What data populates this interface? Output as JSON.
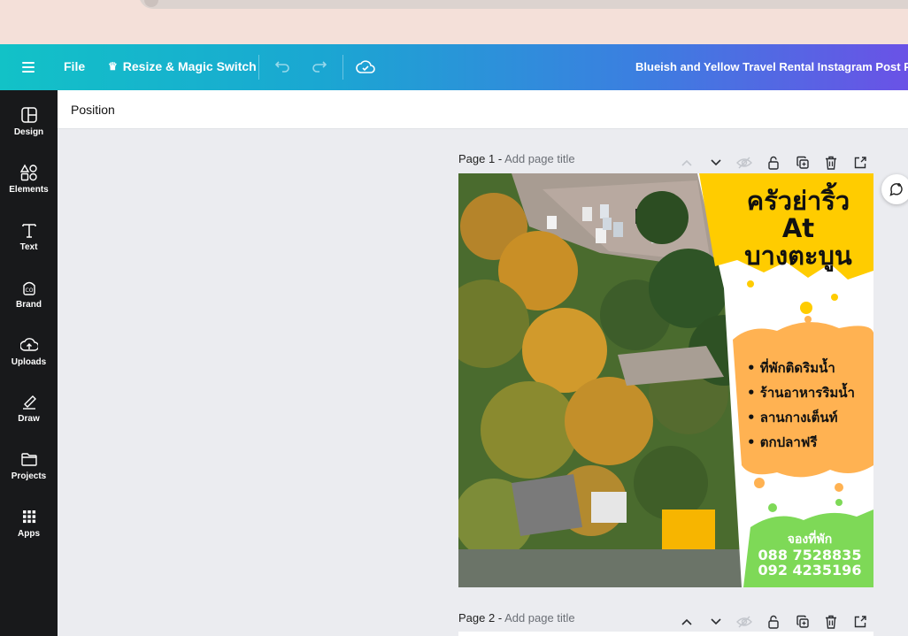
{
  "topbar": {
    "file_label": "File",
    "resize_label": "Resize & Magic Switch",
    "doc_title": "Blueish and Yellow Travel Rental Instagram Post Pr"
  },
  "sidebar": {
    "items": [
      {
        "label": "Design",
        "icon": "design-icon"
      },
      {
        "label": "Elements",
        "icon": "elements-icon"
      },
      {
        "label": "Text",
        "icon": "text-icon"
      },
      {
        "label": "Brand",
        "icon": "brand-icon"
      },
      {
        "label": "Uploads",
        "icon": "uploads-icon"
      },
      {
        "label": "Draw",
        "icon": "draw-icon"
      },
      {
        "label": "Projects",
        "icon": "projects-icon"
      },
      {
        "label": "Apps",
        "icon": "apps-icon"
      }
    ]
  },
  "context_bar": {
    "position_label": "Position"
  },
  "pages": [
    {
      "number_label": "Page 1 -",
      "title_placeholder": "Add page title"
    },
    {
      "number_label": "Page 2 -",
      "title_placeholder": "Add page title"
    }
  ],
  "poster": {
    "title_line1": "ครัวย่าริ้ว",
    "title_line2": "At",
    "title_line3": "บางตะบูน",
    "bullets": [
      "• ที่พักติดริมน้ำ",
      "• ร้านอาหารริมน้ำ",
      "• ลานกางเต็นท์",
      "• ตกปลาฟรี"
    ],
    "booking_label": "จองที่พัก",
    "phone1": "088 7528835",
    "phone2": "092  4235196"
  },
  "colors": {
    "accent_yellow": "#ffcc00",
    "accent_orange": "#ffb252",
    "accent_green": "#7ed957",
    "sidebar_bg": "#18191b"
  }
}
